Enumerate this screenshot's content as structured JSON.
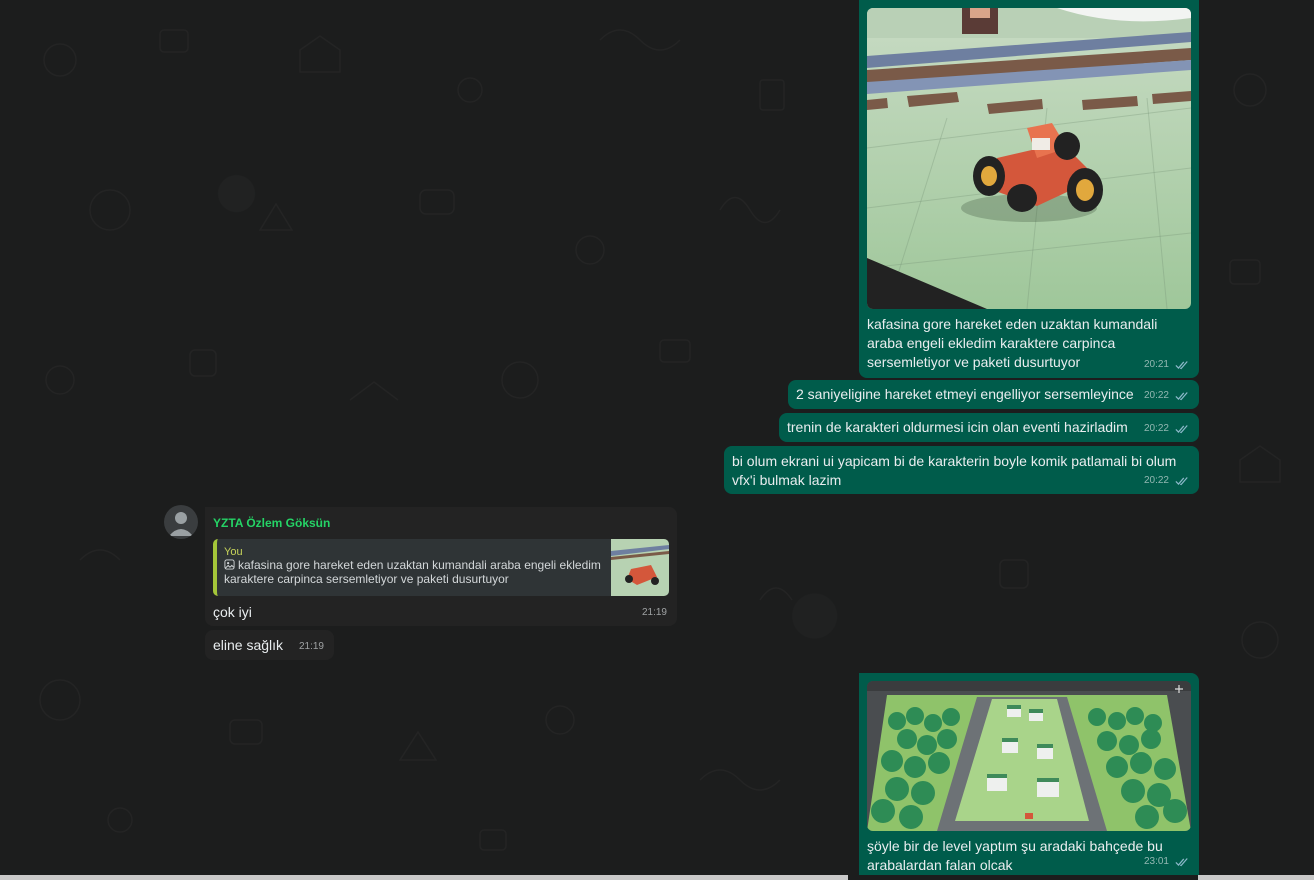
{
  "messages": [
    {
      "direction": "outgoing",
      "has_image": true,
      "image_icon": "race-car-on-railroad-image",
      "text": "kafasina gore hareket eden uzaktan kumandali araba engeli ekledim karaktere carpinca sersemletiyor ve paketi dusurtuyor",
      "time": "20:21",
      "status_icon": "double-check-icon"
    },
    {
      "direction": "outgoing",
      "text": "2 saniyeligine hareket etmeyi engelliyor sersemleyince",
      "time": "20:22",
      "status_icon": "double-check-icon"
    },
    {
      "direction": "outgoing",
      "text": "trenin de karakteri oldurmesi icin olan eventi hazirladim",
      "time": "20:22",
      "status_icon": "double-check-icon"
    },
    {
      "direction": "outgoing",
      "text": "bi olum ekrani ui yapicam bi de karakterin boyle komik patlamali bi olum vfx'i bulmak lazim",
      "time": "20:22",
      "status_icon": "double-check-icon"
    },
    {
      "direction": "incoming",
      "sender": "YZTA Özlem Göksün",
      "quote": {
        "author": "You",
        "text": "kafasina gore hareket eden uzaktan kumandali araba engeli ekledim karaktere carpinca sersemletiyor ve paketi dusurtuyor",
        "icon": "photo-icon"
      },
      "text": "çok iyi",
      "time": "21:19"
    },
    {
      "direction": "incoming",
      "text": "eline sağlık",
      "time": "21:19"
    },
    {
      "direction": "outgoing",
      "has_image": true,
      "image_icon": "city-level-aerial-image",
      "text": "şöyle bir de level yaptım şu aradaki bahçede bu arabalardan falan olcak",
      "time": "23:01",
      "status_icon": "double-check-icon"
    }
  ],
  "colors": {
    "outgoing_bubble": "#005c4b",
    "incoming_bubble": "#232323",
    "sender_name": "#25d366",
    "quote_bar": "#a4c639",
    "read_ticks": "#8bb8c9",
    "background": "#1c1d1d"
  }
}
